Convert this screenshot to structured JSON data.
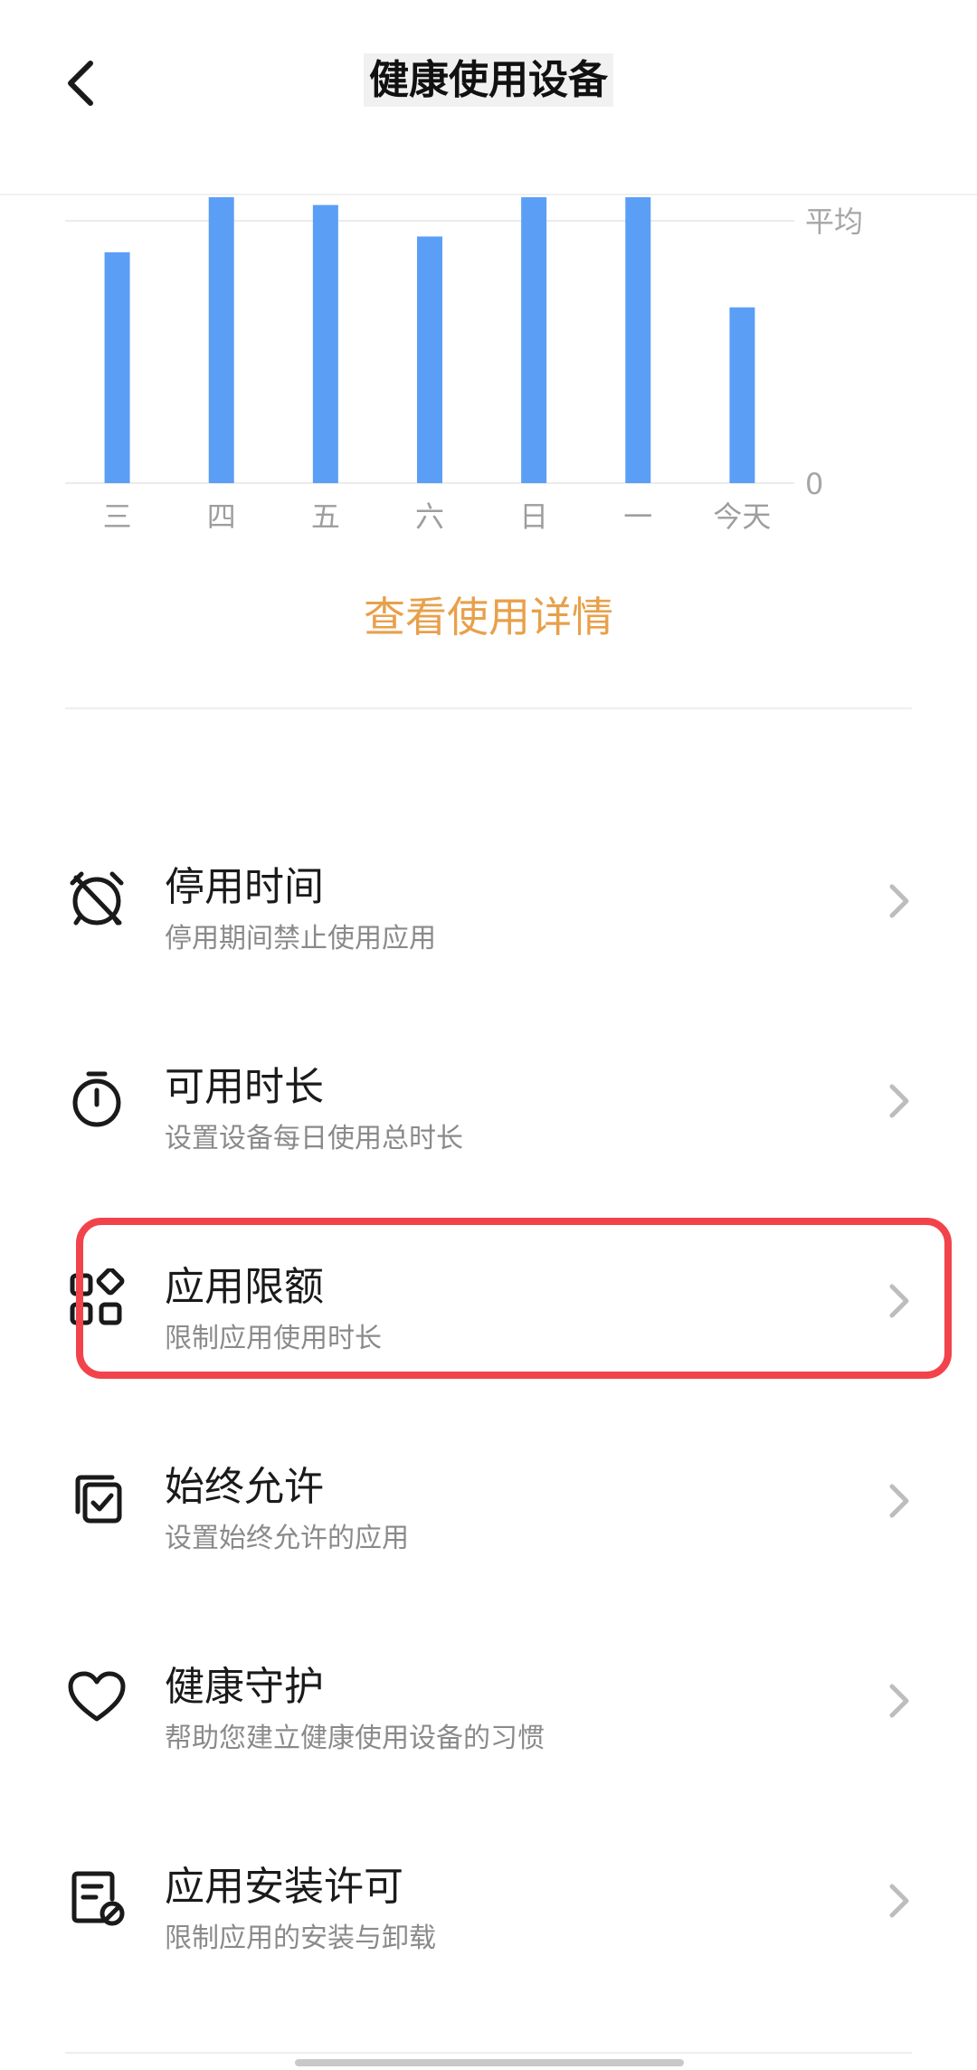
{
  "header": {
    "title": "健康使用设备",
    "back_icon": "chevron-left-icon"
  },
  "chart_data": {
    "type": "bar",
    "categories": [
      "三",
      "四",
      "五",
      "六",
      "日",
      "一",
      "今天"
    ],
    "values": [
      0.88,
      1.15,
      1.06,
      0.94,
      1.15,
      1.15,
      0.67
    ],
    "y_labels": {
      "top": "平均",
      "bottom": "0"
    },
    "ylim": [
      0,
      1
    ],
    "bar_color": "#5b9ef5",
    "grid": true
  },
  "details_link": "查看使用详情",
  "accent_color": "#e8a04a",
  "menu": [
    {
      "icon": "alarm-off-icon",
      "title": "停用时间",
      "subtitle": "停用期间禁止使用应用"
    },
    {
      "icon": "timer-icon",
      "title": "可用时长",
      "subtitle": "设置设备每日使用总时长"
    },
    {
      "icon": "app-grid-icon",
      "title": "应用限额",
      "subtitle": "限制应用使用时长"
    },
    {
      "icon": "check-copy-icon",
      "title": "始终允许",
      "subtitle": "设置始终允许的应用"
    },
    {
      "icon": "heart-icon",
      "title": "健康守护",
      "subtitle": "帮助您建立健康使用设备的习惯"
    },
    {
      "icon": "install-block-icon",
      "title": "应用安装许可",
      "subtitle": "限制应用的安装与卸载"
    }
  ],
  "highlight_color": "#f2434b"
}
